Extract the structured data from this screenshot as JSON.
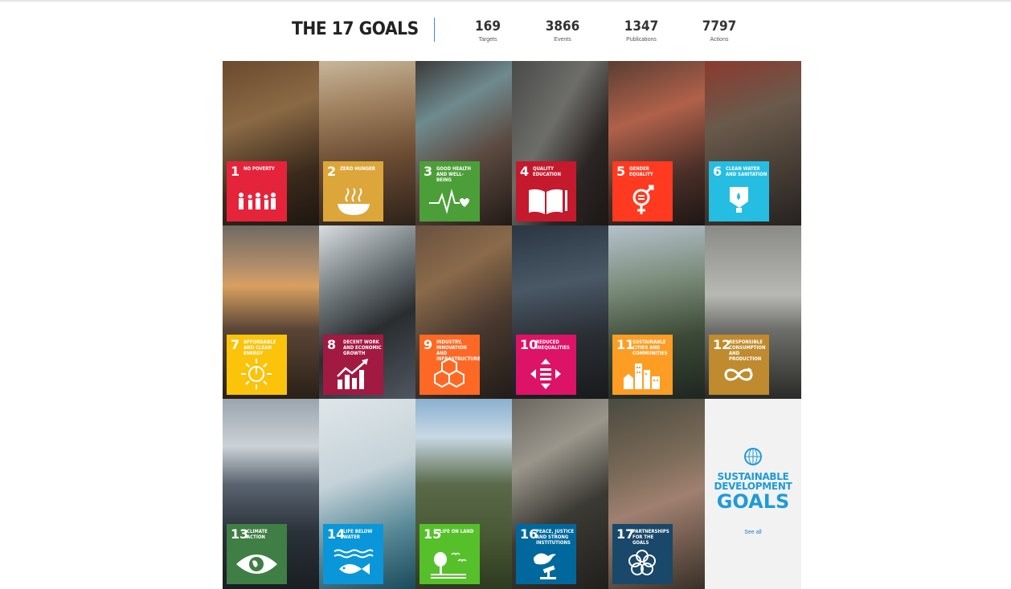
{
  "header": {
    "title": "THE 17 GOALS",
    "stats": [
      {
        "value": "169",
        "label": "Targets"
      },
      {
        "value": "3866",
        "label": "Events"
      },
      {
        "value": "1347",
        "label": "Publications"
      },
      {
        "value": "7797",
        "label": "Actions"
      }
    ]
  },
  "goals": [
    {
      "number": "1",
      "name": "No Poverty",
      "color": "#e5243b",
      "icon": "people-icon"
    },
    {
      "number": "2",
      "name": "Zero Hunger",
      "color": "#dda63a",
      "icon": "bowl-icon"
    },
    {
      "number": "3",
      "name": "Good Health and Well-Being",
      "color": "#4c9f38",
      "icon": "heartbeat-icon"
    },
    {
      "number": "4",
      "name": "Quality Education",
      "color": "#c5192d",
      "icon": "book-icon"
    },
    {
      "number": "5",
      "name": "Gender Equality",
      "color": "#ff3a21",
      "icon": "gender-icon"
    },
    {
      "number": "6",
      "name": "Clean Water and Sanitation",
      "color": "#26bde2",
      "icon": "water-drop-icon"
    },
    {
      "number": "7",
      "name": "Affordable and Clean Energy",
      "color": "#fcc30b",
      "icon": "power-sun-icon"
    },
    {
      "number": "8",
      "name": "Decent Work and Economic Growth",
      "color": "#a21942",
      "icon": "growth-chart-icon"
    },
    {
      "number": "9",
      "name": "Industry, Innovation and Infrastructure",
      "color": "#fd6925",
      "icon": "cubes-icon"
    },
    {
      "number": "10",
      "name": "Reduced Inequalities",
      "color": "#dd1367",
      "icon": "equality-arrows-icon"
    },
    {
      "number": "11",
      "name": "Sustainable Cities and Communities",
      "color": "#fd9d24",
      "icon": "buildings-icon"
    },
    {
      "number": "12",
      "name": "Responsible Consumption and Production",
      "color": "#bf8b2e",
      "icon": "infinity-icon"
    },
    {
      "number": "13",
      "name": "Climate Action",
      "color": "#3f7e44",
      "icon": "eye-globe-icon"
    },
    {
      "number": "14",
      "name": "Life Below Water",
      "color": "#0a97d9",
      "icon": "fish-icon"
    },
    {
      "number": "15",
      "name": "Life on Land",
      "color": "#56c02b",
      "icon": "tree-birds-icon"
    },
    {
      "number": "16",
      "name": "Peace, Justice and Strong Institutions",
      "color": "#00689d",
      "icon": "dove-gavel-icon"
    },
    {
      "number": "17",
      "name": "Partnerships for the Goals",
      "color": "#19486a",
      "icon": "rings-icon"
    }
  ],
  "sdg_logo": {
    "line1": "SUSTAINABLE",
    "line2": "DEVELOPMENT",
    "line3": "GOALS",
    "see_all": "See all"
  }
}
